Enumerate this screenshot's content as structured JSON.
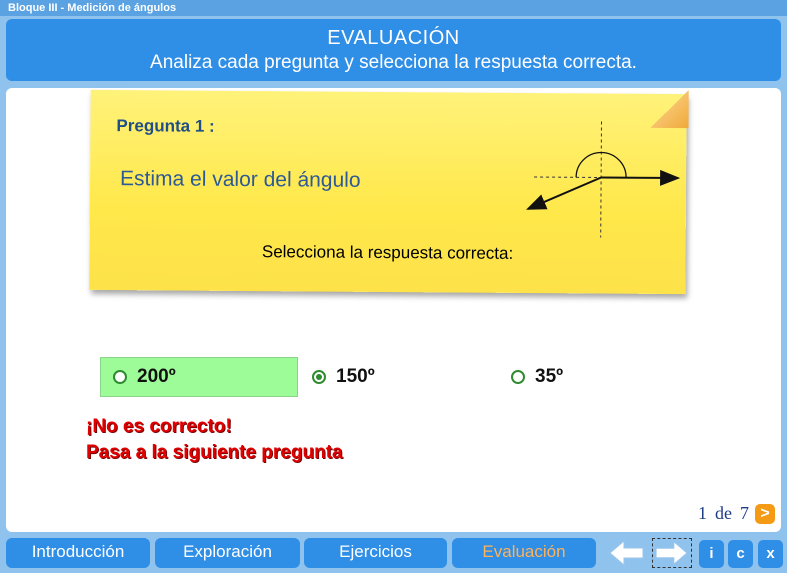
{
  "window": {
    "title": "Bloque III - Medición de ángulos"
  },
  "header": {
    "title": "EVALUACIÓN",
    "subtitle": "Analiza cada pregunta y selecciona la respuesta correcta."
  },
  "question": {
    "label": "Pregunta 1 :",
    "text": "Estima el valor del ángulo",
    "instruction": "Selecciona la respuesta correcta:"
  },
  "options": [
    {
      "label": "200º",
      "selected": false,
      "correct": true
    },
    {
      "label": "150º",
      "selected": true,
      "correct": false
    },
    {
      "label": "35º",
      "selected": false,
      "correct": false
    }
  ],
  "feedback": {
    "line1": "¡No es correcto!",
    "line2": "Pasa a la siguiente pregunta"
  },
  "pager": {
    "current": "1",
    "of": "de",
    "total": "7",
    "next": ">"
  },
  "nav": {
    "tabs": [
      "Introducción",
      "Exploración",
      "Ejercicios",
      "Evaluación"
    ],
    "active": "Evaluación",
    "info": "i",
    "credits": "c",
    "close": "x"
  },
  "colors": {
    "accent": "#2f8ee6",
    "note": "#ffe84a",
    "feedback": "#e00000",
    "correct": "#9dfc98"
  }
}
